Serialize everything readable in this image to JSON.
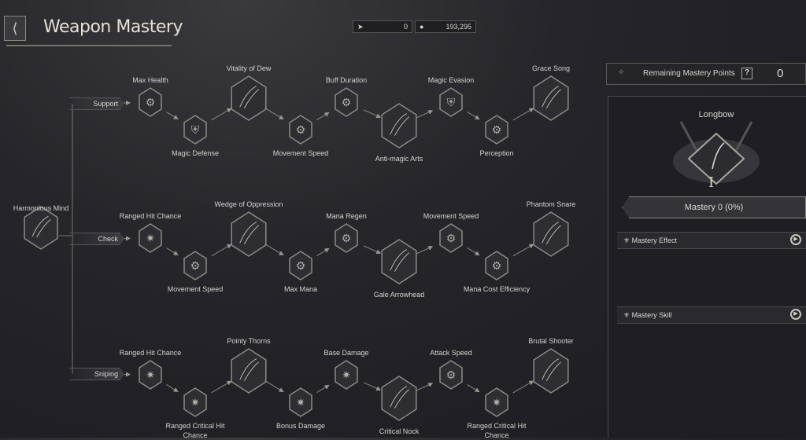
{
  "header": {
    "title": "Weapon Mastery",
    "back_icon": "back-arrow-icon",
    "currency": [
      {
        "icon": "feather-icon",
        "value": "0"
      },
      {
        "icon": "coin-icon",
        "value": "193,295"
      }
    ]
  },
  "root": {
    "label": "Harmonious Mind"
  },
  "branches": [
    {
      "label": "Support",
      "nodes": [
        "Max Health",
        "Magic Defense",
        "Vitality of Dew",
        "Movement Speed",
        "Buff Duration",
        "Anti-magic Arts",
        "Magic Evasion",
        "Perception",
        "Grace Song"
      ],
      "icons": [
        "gear-icon",
        "shield-icon",
        "bow-icon",
        "gear-icon",
        "gear-icon",
        "bow-icon",
        "shield-icon",
        "gear-icon",
        "bow-icon"
      ]
    },
    {
      "label": "Check",
      "nodes": [
        "Ranged Hit Chance",
        "Movement Speed",
        "Wedge of Oppression",
        "Max Mana",
        "Mana Regen",
        "Gale Arrowhead",
        "Movement Speed",
        "Mana Cost Efficiency",
        "Phantom Snare"
      ],
      "icons": [
        "burst-icon",
        "gear-icon",
        "bow-icon",
        "gear-icon",
        "gear-icon",
        "bow-icon",
        "gear-icon",
        "gear-icon",
        "bow-icon"
      ]
    },
    {
      "label": "Sniping",
      "nodes": [
        "Ranged Hit Chance",
        "Ranged Critical Hit Chance",
        "Pointy Thorns",
        "Bonus Damage",
        "Base Damage",
        "Critical Nock",
        "Attack Speed",
        "Ranged Critical Hit Chance",
        "Brutal Shooter"
      ],
      "icons": [
        "burst-icon",
        "burst-icon",
        "bow-icon",
        "burst-icon",
        "burst-icon",
        "bow-icon",
        "gear-icon",
        "burst-icon",
        "bow-icon"
      ]
    }
  ],
  "panel": {
    "remaining_label": "Remaining Mastery Points",
    "help": "?",
    "remaining_value": "0",
    "weapon": "Longbow",
    "rank": "I",
    "mastery": "Mastery 0",
    "mastery_pct": "(0%)",
    "progress": 0,
    "effect_label": "Mastery Effect",
    "skill_label": "Mastery Skill"
  }
}
